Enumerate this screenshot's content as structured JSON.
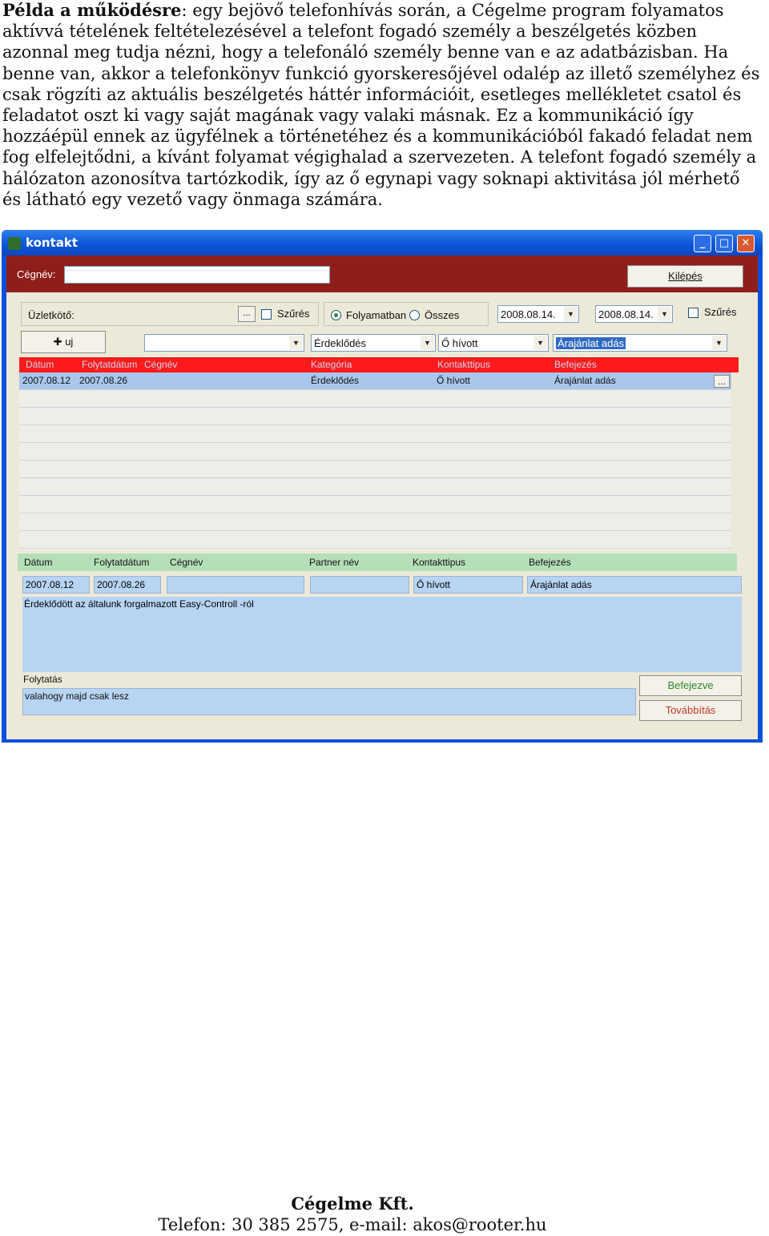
{
  "intro": {
    "heading": "Példa a működésre",
    "body": ": egy bejövő telefonhívás során, a Cégelme program folyamatos aktívvá tételének feltételezésével a telefont fogadó személy a beszélgetés közben azonnal meg tudja nézni, hogy a telefonáló személy benne van e az adatbázisban. Ha benne van, akkor a telefonkönyv funkció gyorskeresőjével odalép az illető személyhez és csak rögzíti az aktuális beszélgetés háttér információit, esetleges mellékletet csatol és feladatot oszt ki vagy saját magának vagy valaki másnak. Ez a kommunikáció így hozzáépül ennek az ügyfélnek a történetéhez és a kommunikációból fakadó feladat nem fog elfelejtődni, a kívánt folyamat végighalad a szervezeten. A telefont fogadó személy a hálózaton azonosítva tartózkodik, így az ő egynapi vagy soknapi aktivitása jól mérhető és látható egy vezető vagy önmaga számára."
  },
  "window": {
    "title": "kontakt",
    "minimize": "_",
    "maximize": "□",
    "close": "✕"
  },
  "top": {
    "cegnev_label": "Cégnév:",
    "cegnev_value": "",
    "kilepes_label": "Kilépés"
  },
  "filters": {
    "uzletkoto_label": "Üzletkötő:",
    "ellipsis": "...",
    "szures1": "Szűrés",
    "folyamatban": "Folyamatban",
    "osszes": "Összes",
    "date_from": "2008.08.14.",
    "date_to": "2008.08.14.",
    "szures2": "Szűrés",
    "uj_label": "uj",
    "combo_blank": "",
    "combo_category": "Érdeklődés",
    "combo_contact": "Ő hívott",
    "combo_result": "Árajánlat adás"
  },
  "grid": {
    "headers": [
      "Dátum",
      "Folytatdátum",
      "Cégnév",
      "Kategória",
      "Kontakttipus",
      "Befejezés"
    ],
    "row": {
      "datum": "2007.08.12",
      "folytat": "2007.08.26",
      "kategoria": "Érdeklődés",
      "kontakt": "Ő hívott",
      "befejezes": "Árajánlat adás",
      "ellipsis": "..."
    }
  },
  "detail": {
    "headers": [
      "Dátum",
      "Folytatdátum",
      "Cégnév",
      "Partner név",
      "Kontakttipus",
      "Befejezés"
    ],
    "datum": "2007.08.12",
    "folytat": "2007.08.26",
    "kontakt": "Ő hívott",
    "befejezes": "Árajánlat adás",
    "note": "Érdeklődött az általunk forgalmazott Easy-Controll -ról",
    "folytatas_label": "Folytatás",
    "folytatas_value": "valahogy majd csak lesz",
    "befejezve_label": "Befejezve",
    "tovabbitas_label": "Továbbítás"
  },
  "footer": {
    "company": "Cégelme Kft.",
    "contact": "Telefon: 30 385 2575, e-mail: akos@rooter.hu"
  },
  "colors": {
    "title_blue": "#0b54d6",
    "red_bar": "#8f1e1b",
    "grid_header_red": "#ff1b1b",
    "row_blue": "#a9c6ec",
    "detail_header_green": "#b5dfb8",
    "button_text_green": "#2b8a2b",
    "button_text_red": "#c0392b"
  }
}
